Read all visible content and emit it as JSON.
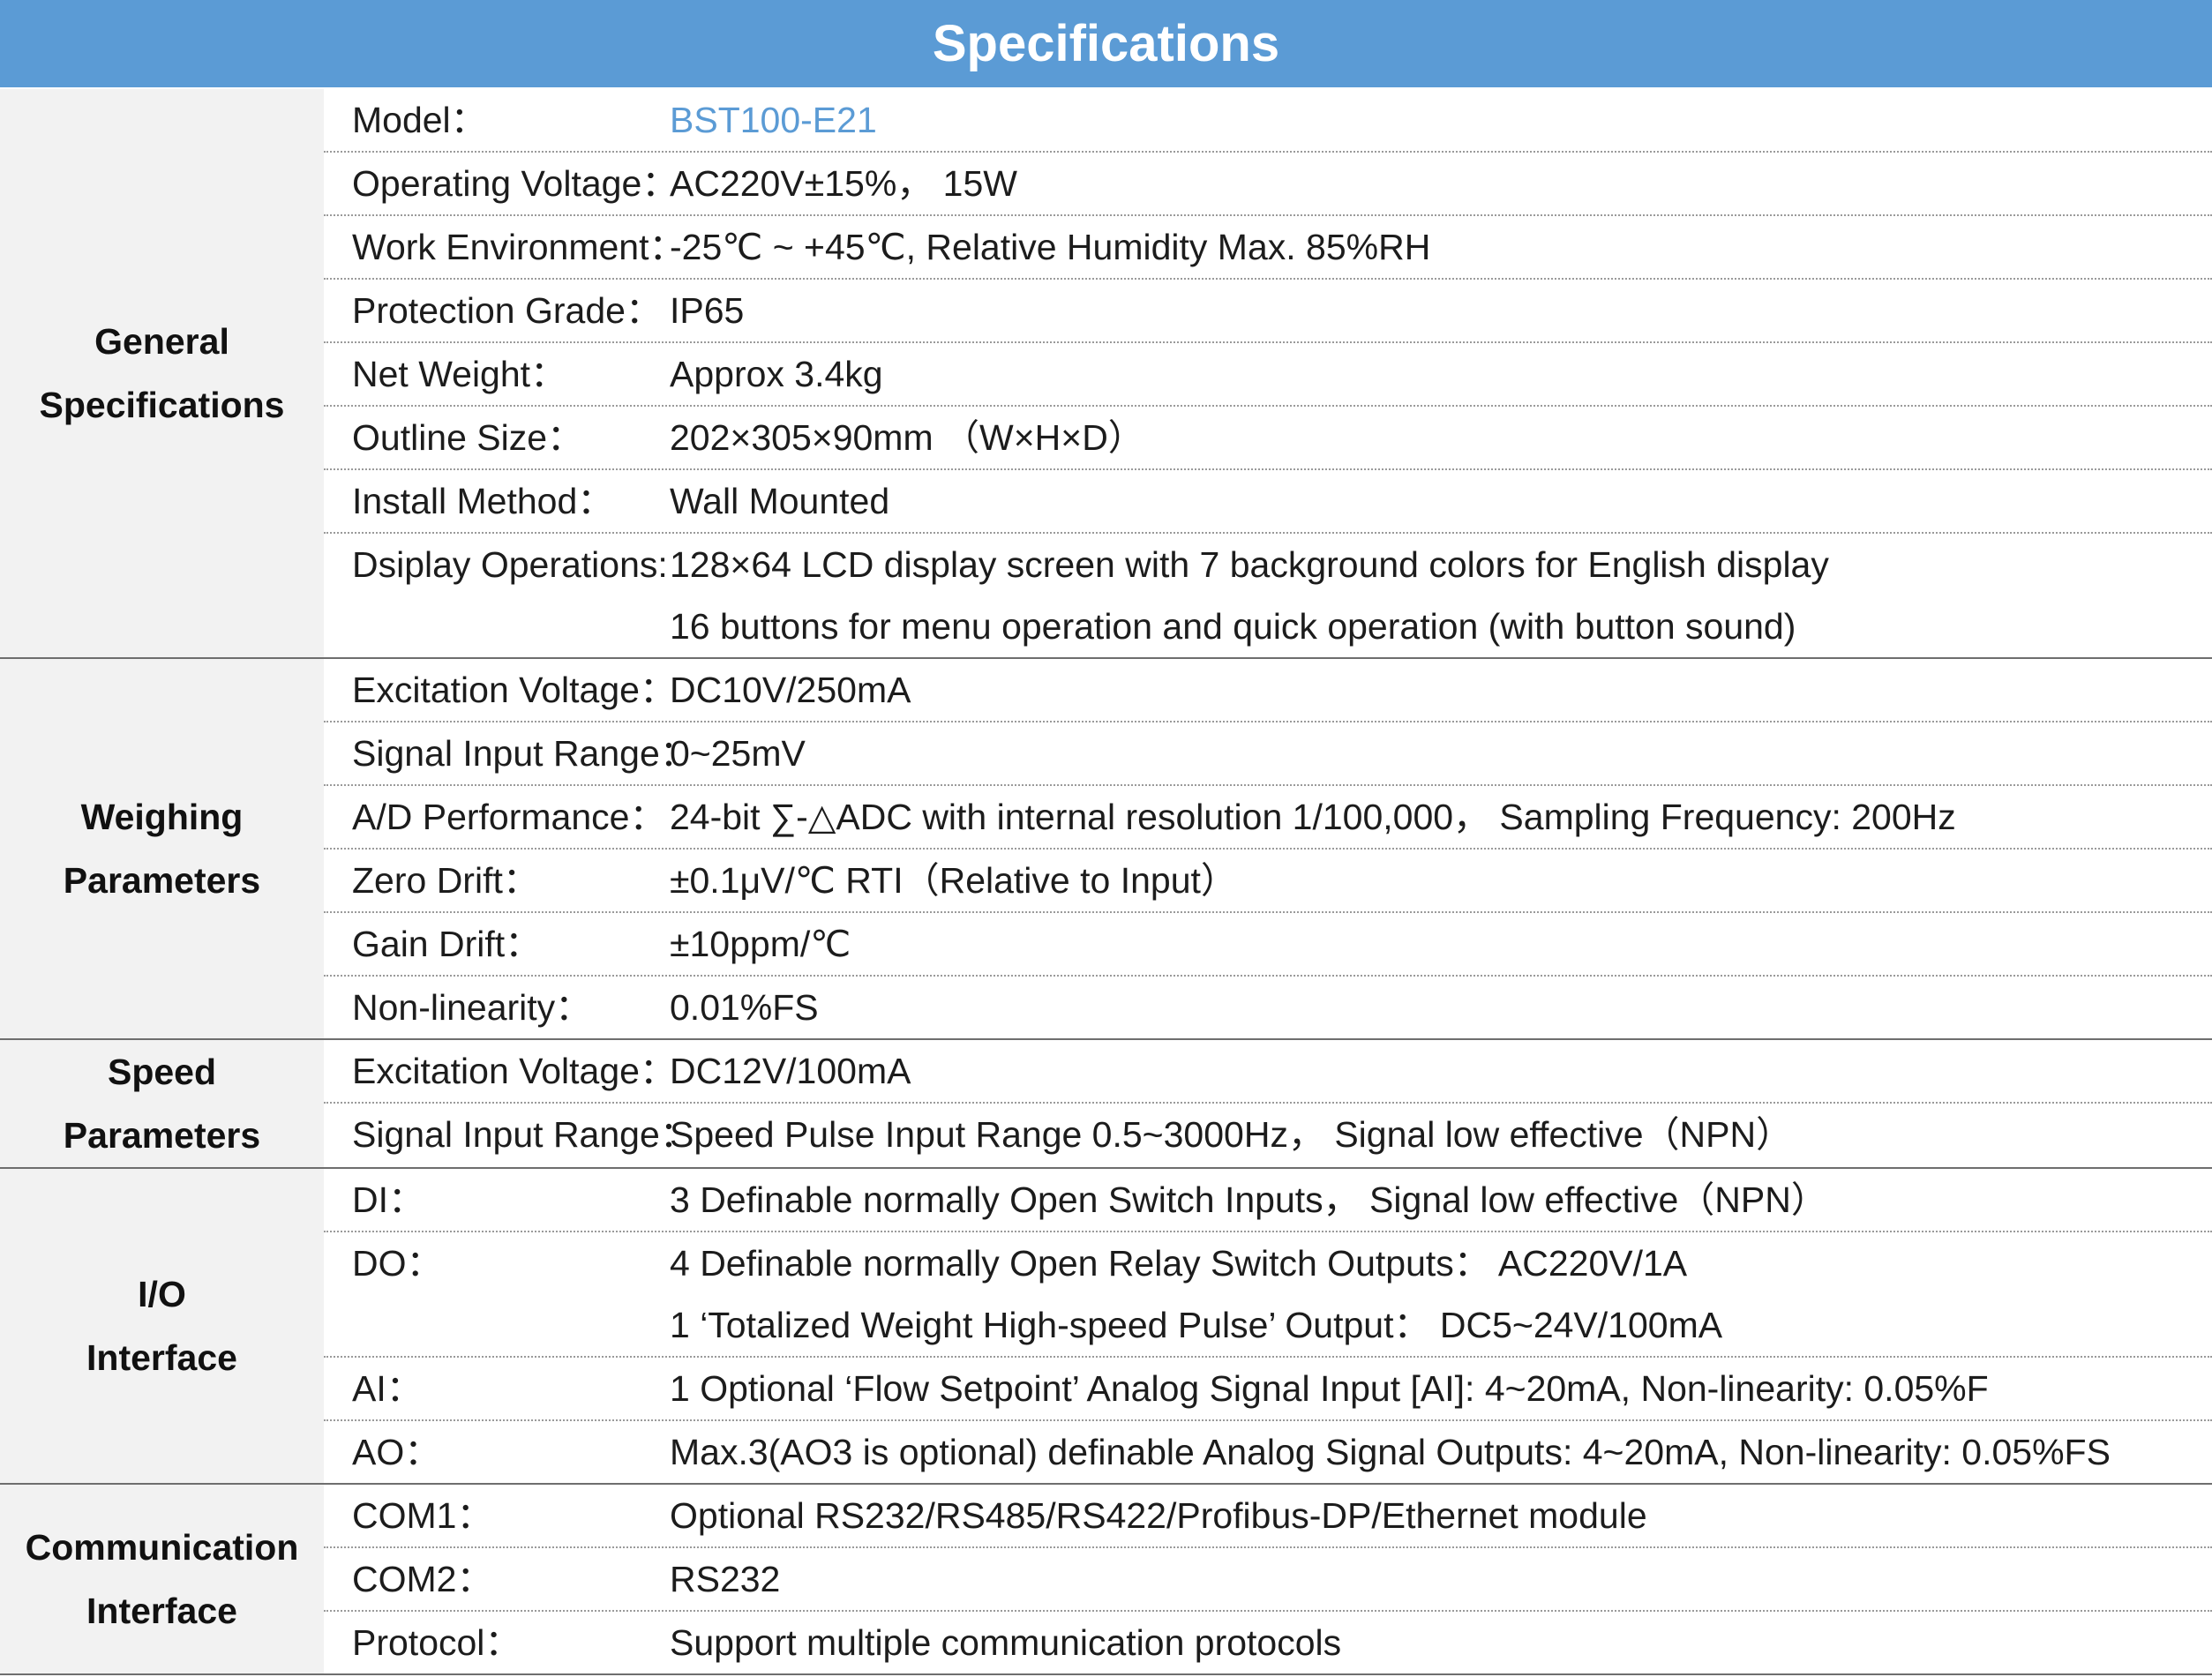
{
  "title": "Specifications",
  "sections": [
    {
      "label_lines": [
        "General",
        "Specifications"
      ],
      "rows": [
        {
          "label": "Model：",
          "values": [
            "BST100-E21"
          ],
          "accent": true
        },
        {
          "label": "Operating Voltage：",
          "values": [
            "AC220V±15%， 15W"
          ]
        },
        {
          "label": "Work Environment：",
          "values": [
            "-25℃ ~ +45℃, Relative Humidity Max. 85%RH"
          ]
        },
        {
          "label": "Protection Grade：",
          "values": [
            "IP65"
          ]
        },
        {
          "label": "Net Weight：",
          "values": [
            "Approx  3.4kg"
          ]
        },
        {
          "label": "Outline Size：",
          "values": [
            "202×305×90mm （W×H×D）"
          ]
        },
        {
          "label": "Install Method：",
          "values": [
            "Wall Mounted"
          ]
        },
        {
          "label": "Dsiplay Operations:",
          "values": [
            "128×64 LCD display screen with 7 background colors for English display",
            "16 buttons for menu operation and quick operation (with button sound)"
          ]
        }
      ]
    },
    {
      "label_lines": [
        "Weighing",
        "Parameters"
      ],
      "rows": [
        {
          "label": "Excitation Voltage：",
          "values": [
            "DC10V/250mA"
          ]
        },
        {
          "label": "Signal Input Range：",
          "values": [
            "0~25mV"
          ]
        },
        {
          "label": "A/D Performance：",
          "values": [
            "24-bit ∑-△ADC with internal resolution 1/100,000， Sampling Frequency: 200Hz"
          ]
        },
        {
          "label": "Zero Drift：",
          "values": [
            "±0.1μV/℃ RTI（Relative to Input）"
          ]
        },
        {
          "label": "Gain Drift：",
          "values": [
            "±10ppm/℃"
          ]
        },
        {
          "label": "Non-linearity：",
          "values": [
            "0.01%FS"
          ]
        }
      ]
    },
    {
      "label_lines": [
        "Speed",
        "Parameters"
      ],
      "rows": [
        {
          "label": "Excitation Voltage：",
          "values": [
            "DC12V/100mA"
          ]
        },
        {
          "label": "Signal Input Range：",
          "values": [
            "Speed Pulse Input Range  0.5~3000Hz， Signal low effective（NPN）"
          ]
        }
      ]
    },
    {
      "label_lines": [
        "I/O",
        "Interface"
      ],
      "rows": [
        {
          "label": "DI：",
          "values": [
            "3 Definable normally Open Switch Inputs， Signal low effective（NPN）"
          ]
        },
        {
          "label": "DO：",
          "values": [
            "4 Definable normally Open Relay Switch Outputs： AC220V/1A",
            "1 ‘Totalized Weight High-speed Pulse’ Output： DC5~24V/100mA"
          ]
        },
        {
          "label": "AI：",
          "values": [
            "1 Optional ‘Flow Setpoint’ Analog Signal Input [AI]: 4~20mA, Non-linearity: 0.05%F"
          ]
        },
        {
          "label": "AO：",
          "values": [
            "Max.3(AO3 is optional) definable Analog Signal Outputs: 4~20mA, Non-linearity: 0.05%FS"
          ]
        }
      ]
    },
    {
      "label_lines": [
        "Communication",
        "Interface"
      ],
      "rows": [
        {
          "label": "COM1：",
          "values": [
            "Optional RS232/RS485/RS422/Profibus-DP/Ethernet module"
          ]
        },
        {
          "label": "COM2：",
          "values": [
            "RS232"
          ]
        },
        {
          "label": "Protocol：",
          "values": [
            "Support multiple communication protocols"
          ]
        }
      ]
    }
  ]
}
